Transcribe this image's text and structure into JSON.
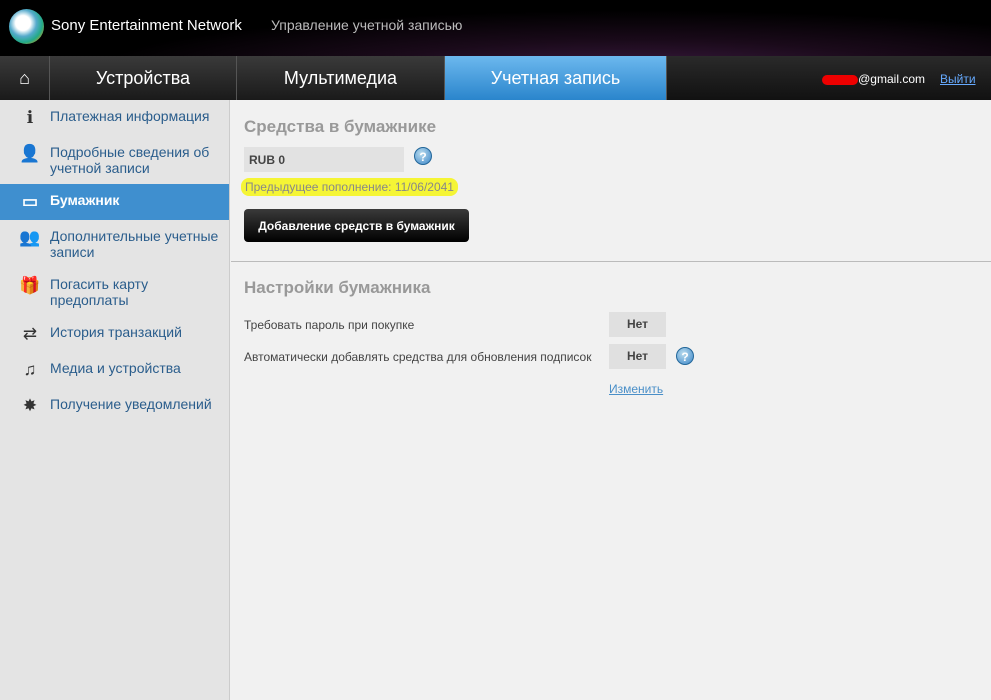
{
  "header": {
    "brand": "Sony Entertainment Network",
    "subtitle": "Управление учетной записью",
    "email": "@gmail.com",
    "logout": "Выйти"
  },
  "nav": {
    "tabs": [
      {
        "label": "Устройства"
      },
      {
        "label": "Мультимедиа"
      },
      {
        "label": "Учетная запись"
      }
    ]
  },
  "sidebar": {
    "items": [
      {
        "label": "Платежная информация",
        "icon": "info-icon"
      },
      {
        "label": "Подробные сведения об учетной записи",
        "icon": "user-icon"
      },
      {
        "label": "Бумажник",
        "icon": "wallet-icon"
      },
      {
        "label": "Дополнительные учетные записи",
        "icon": "users-icon"
      },
      {
        "label": "Погасить карту предоплаты",
        "icon": "gift-icon"
      },
      {
        "label": "История транзакций",
        "icon": "arrows-icon"
      },
      {
        "label": "Медиа и устройства",
        "icon": "media-icon"
      },
      {
        "label": "Получение уведомлений",
        "icon": "badge-icon"
      }
    ]
  },
  "wallet": {
    "title": "Средства в бумажнике",
    "balance": "RUB 0",
    "previous": "Предыдущее пополнение: 11/06/2041",
    "add_button": "Добавление средств в бумажник"
  },
  "settings": {
    "title": "Настройки бумажника",
    "rows": [
      {
        "label": "Требовать пароль при покупке",
        "value": "Нет"
      },
      {
        "label": "Автоматически добавлять средства для обновления подписок",
        "value": "Нет"
      }
    ],
    "change": "Изменить"
  }
}
